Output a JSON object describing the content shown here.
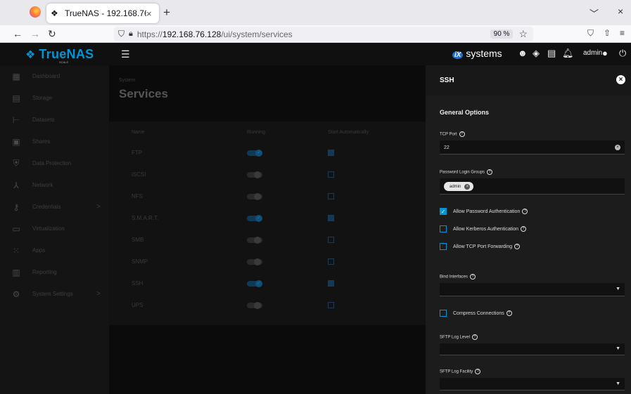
{
  "browser": {
    "tab_title": "TrueNAS - 192.168.76.128",
    "tab_close": "×",
    "new_tab": "+",
    "url_prefix": "https://",
    "url_host": "192.168.76.128",
    "url_path": "/ui/system/services",
    "zoom": "90 %"
  },
  "topbar": {
    "brand": "TrueNAS",
    "edition": "SCALE",
    "ix_brand": "systems",
    "user": "admin"
  },
  "sidebar": {
    "items": [
      {
        "label": "Dashboard",
        "icon": "dashboard-icon",
        "arrow": ""
      },
      {
        "label": "Storage",
        "icon": "storage-icon",
        "arrow": ""
      },
      {
        "label": "Datasets",
        "icon": "datasets-icon",
        "arrow": ""
      },
      {
        "label": "Shares",
        "icon": "shares-icon",
        "arrow": ""
      },
      {
        "label": "Data Protection",
        "icon": "shield-icon",
        "arrow": ""
      },
      {
        "label": "Network",
        "icon": "network-icon",
        "arrow": ""
      },
      {
        "label": "Credentials",
        "icon": "key-icon",
        "arrow": ">"
      },
      {
        "label": "Virtualization",
        "icon": "monitor-icon",
        "arrow": ""
      },
      {
        "label": "Apps",
        "icon": "apps-grid-icon",
        "arrow": ""
      },
      {
        "label": "Reporting",
        "icon": "reporting-icon",
        "arrow": ""
      },
      {
        "label": "System Settings",
        "icon": "gear-icon",
        "arrow": ">"
      }
    ]
  },
  "main": {
    "breadcrumb": "System",
    "title": "Services",
    "columns": [
      "Name",
      "Running",
      "Start Automatically"
    ],
    "services": [
      {
        "name": "FTP",
        "running": true,
        "auto": true
      },
      {
        "name": "iSCSI",
        "running": false,
        "auto": false
      },
      {
        "name": "NFS",
        "running": false,
        "auto": false
      },
      {
        "name": "S.M.A.R.T.",
        "running": true,
        "auto": true
      },
      {
        "name": "SMB",
        "running": false,
        "auto": false
      },
      {
        "name": "SNMP",
        "running": false,
        "auto": false
      },
      {
        "name": "SSH",
        "running": true,
        "auto": true
      },
      {
        "name": "UPS",
        "running": false,
        "auto": false
      }
    ]
  },
  "panel": {
    "title": "SSH",
    "section": "General Options",
    "tcp_port_label": "TCP Port",
    "tcp_port_value": "22",
    "login_groups_label": "Password Login Groups",
    "login_group_chip": "admin",
    "allow_password_label": "Allow Password Authentication",
    "allow_password_checked": true,
    "allow_kerberos_label": "Allow Kerberos Authentication",
    "allow_kerberos_checked": false,
    "allow_tcp_forwarding_label": "Allow TCP Port Forwarding",
    "allow_tcp_forwarding_checked": false,
    "bind_interfaces_label": "Bind Interfaces",
    "compress_label": "Compress Connections",
    "compress_checked": false,
    "sftp_log_level_label": "SFTP Log Level",
    "sftp_log_facility_label": "SFTP Log Facility"
  },
  "colors": {
    "accent": "#0095d5",
    "panel_bg": "#1c1c1c",
    "app_bg": "#0c0c0c"
  }
}
